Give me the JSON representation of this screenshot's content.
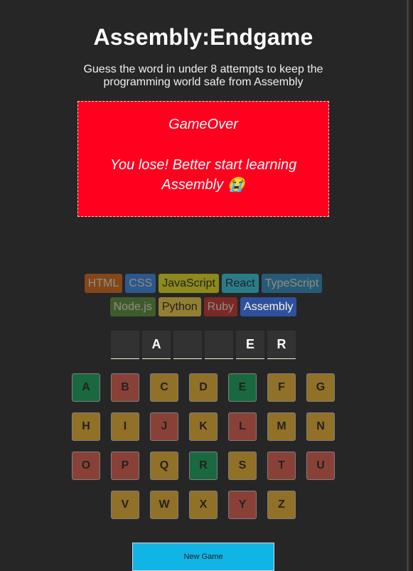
{
  "header": {
    "title": "Assembly:Endgame",
    "subtitle": "Guess the word in under 8 attempts to keep the programming world safe from Assembly"
  },
  "status": {
    "title": "GameOver",
    "message": "You lose! Better start learning Assembly 😭"
  },
  "languages": [
    {
      "name": "HTML",
      "bg": "#E2680F",
      "fg": "#F9F4DA",
      "lost": true
    },
    {
      "name": "CSS",
      "bg": "#328AF1",
      "fg": "#F9F4DA",
      "lost": true
    },
    {
      "name": "JavaScript",
      "bg": "#F4EB13",
      "fg": "#1E1E1E",
      "lost": true
    },
    {
      "name": "React",
      "bg": "#2ED3E9",
      "fg": "#1E1E1E",
      "lost": true
    },
    {
      "name": "TypeScript",
      "bg": "#298EC6",
      "fg": "#F9F4DA",
      "lost": true
    },
    {
      "name": "Node.js",
      "bg": "#599137",
      "fg": "#F9F4DA",
      "lost": true
    },
    {
      "name": "Python",
      "bg": "#FFD742",
      "fg": "#1E1E1E",
      "lost": true
    },
    {
      "name": "Ruby",
      "bg": "#D02B2B",
      "fg": "#F9F4DA",
      "lost": true
    },
    {
      "name": "Assembly",
      "bg": "#2D519F",
      "fg": "#F9F4DA",
      "lost": false
    }
  ],
  "word": [
    {
      "letter": ""
    },
    {
      "letter": "A"
    },
    {
      "letter": ""
    },
    {
      "letter": ""
    },
    {
      "letter": "E"
    },
    {
      "letter": "R"
    }
  ],
  "keyboard": [
    {
      "key": "A",
      "state": "correct"
    },
    {
      "key": "B",
      "state": "wrong"
    },
    {
      "key": "C",
      "state": "unused"
    },
    {
      "key": "D",
      "state": "unused"
    },
    {
      "key": "E",
      "state": "correct"
    },
    {
      "key": "F",
      "state": "unused"
    },
    {
      "key": "G",
      "state": "unused"
    },
    {
      "key": "H",
      "state": "unused"
    },
    {
      "key": "I",
      "state": "unused"
    },
    {
      "key": "J",
      "state": "wrong"
    },
    {
      "key": "K",
      "state": "unused"
    },
    {
      "key": "L",
      "state": "wrong"
    },
    {
      "key": "M",
      "state": "unused"
    },
    {
      "key": "N",
      "state": "unused"
    },
    {
      "key": "O",
      "state": "wrong"
    },
    {
      "key": "P",
      "state": "wrong"
    },
    {
      "key": "Q",
      "state": "unused"
    },
    {
      "key": "R",
      "state": "correct"
    },
    {
      "key": "S",
      "state": "unused"
    },
    {
      "key": "T",
      "state": "wrong"
    },
    {
      "key": "U",
      "state": "wrong"
    },
    {
      "key": "V",
      "state": "unused"
    },
    {
      "key": "W",
      "state": "unused"
    },
    {
      "key": "X",
      "state": "unused"
    },
    {
      "key": "Y",
      "state": "wrong"
    },
    {
      "key": "Z",
      "state": "unused"
    }
  ],
  "actions": {
    "new_game_label": "New Game"
  }
}
